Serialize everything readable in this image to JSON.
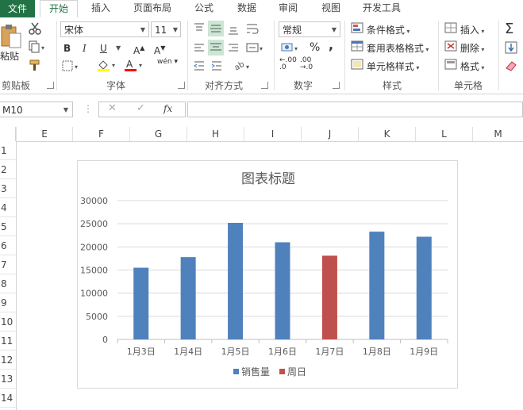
{
  "tabs": {
    "file": "文件",
    "items": [
      "开始",
      "插入",
      "页面布局",
      "公式",
      "数据",
      "审阅",
      "视图",
      "开发工具"
    ],
    "active_index": 0
  },
  "ribbon": {
    "clipboard": {
      "paste_label": "粘贴",
      "group_label": "剪贴板"
    },
    "font": {
      "font_name": "宋体",
      "font_size": "11",
      "group_label": "字体",
      "phonetic_label": "wén"
    },
    "alignment": {
      "group_label": "对齐方式"
    },
    "number": {
      "format": "常规",
      "percent": "%",
      "comma": ",",
      "dec_inc": ".00",
      "dec_dec": ".00",
      "group_label": "数字"
    },
    "styles": {
      "conditional": "条件格式",
      "table_format": "套用表格格式",
      "cell_styles": "单元格样式",
      "group_label": "样式"
    },
    "cells": {
      "insert": "插入",
      "delete": "删除",
      "format": "格式",
      "group_label": "单元格"
    }
  },
  "formula_bar": {
    "name_box": "M10",
    "fx": "fx",
    "formula": ""
  },
  "sheet": {
    "columns": [
      "E",
      "F",
      "G",
      "H",
      "I",
      "J",
      "K",
      "L",
      "M"
    ],
    "rows": [
      "1",
      "2",
      "3",
      "4",
      "5",
      "6",
      "7",
      "8",
      "9",
      "10",
      "11",
      "12",
      "13",
      "14"
    ]
  },
  "colors": {
    "accent": "#217346",
    "bar_blue": "#4f81bd",
    "bar_red": "#c0504d"
  },
  "chart_data": {
    "type": "bar",
    "title": "图表标题",
    "categories": [
      "1月3日",
      "1月4日",
      "1月5日",
      "1月6日",
      "1月7日",
      "1月8日",
      "1月9日"
    ],
    "values": [
      15500,
      17800,
      25200,
      21000,
      18100,
      23300,
      22200
    ],
    "highlight_index": 4,
    "ylim": [
      0,
      30000
    ],
    "yticks": [
      "0",
      "5000",
      "10000",
      "15000",
      "20000",
      "25000",
      "30000"
    ],
    "legend": [
      {
        "name": "销售量",
        "color": "#4f81bd"
      },
      {
        "name": "周日",
        "color": "#c0504d"
      }
    ],
    "legend_position": "bottom",
    "grid": true
  }
}
